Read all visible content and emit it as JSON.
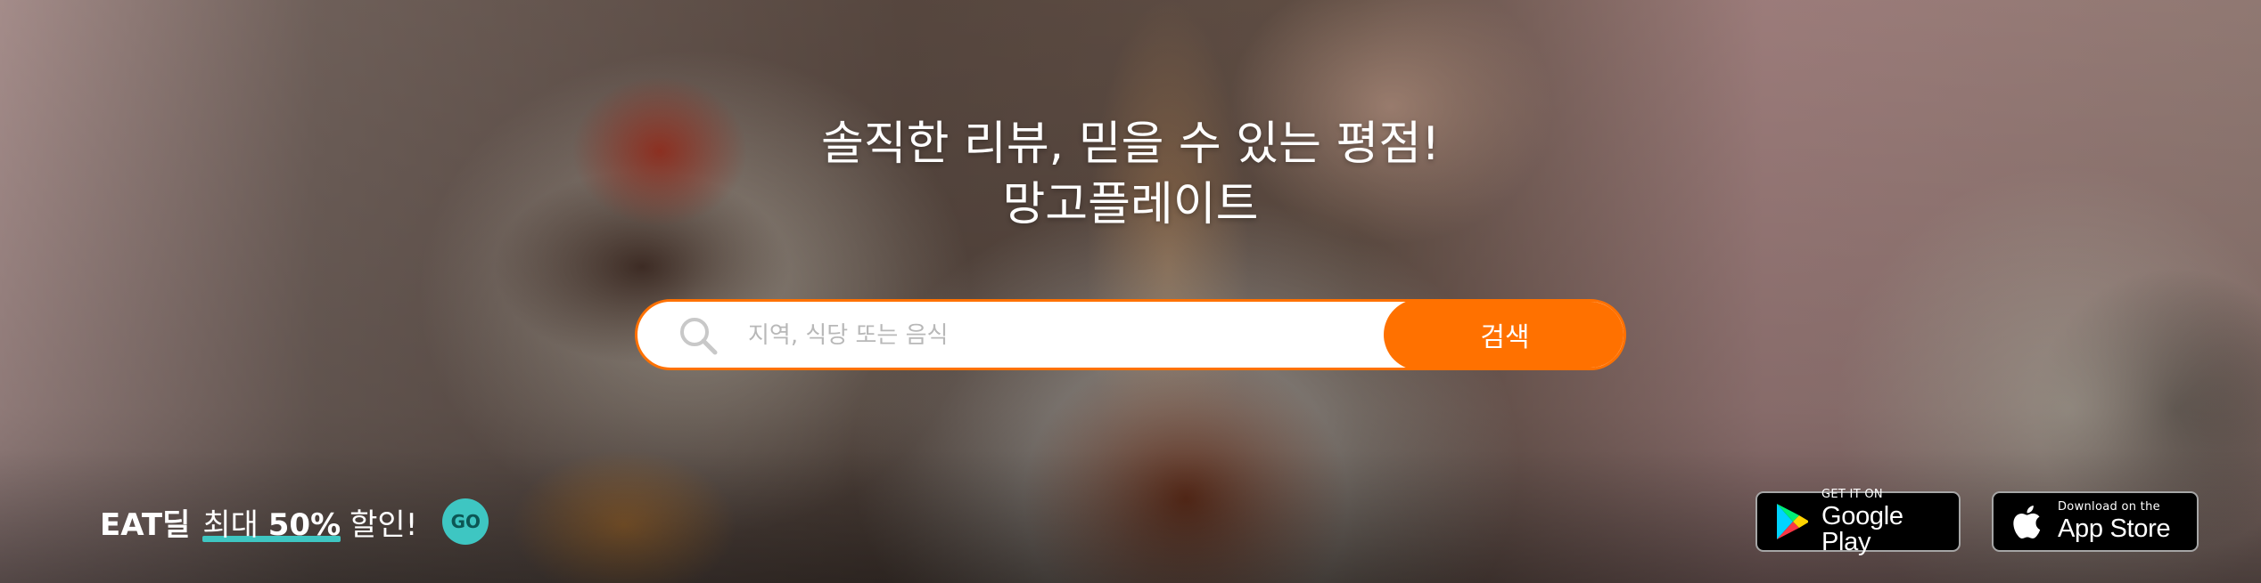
{
  "hero": {
    "headline_line1": "솔직한 리뷰, 믿을 수 있는 평점!",
    "headline_line2": "망고플레이트"
  },
  "search": {
    "placeholder": "지역, 식당 또는 음식",
    "value": "",
    "button_label": "검색",
    "icon": "search-icon"
  },
  "promo": {
    "brand": "EAT딜",
    "highlight_prefix": "최대 ",
    "highlight_percent": "50%",
    "suffix": " 할인!",
    "go_label": "GO"
  },
  "app_badges": {
    "google": {
      "small": "GET IT ON",
      "big": "Google Play",
      "icon": "google-play-icon"
    },
    "apple": {
      "small": "Download on the",
      "big": "App Store",
      "icon": "apple-icon"
    }
  },
  "colors": {
    "accent": "#ff7100",
    "promo_teal": "#3ec6c2"
  }
}
